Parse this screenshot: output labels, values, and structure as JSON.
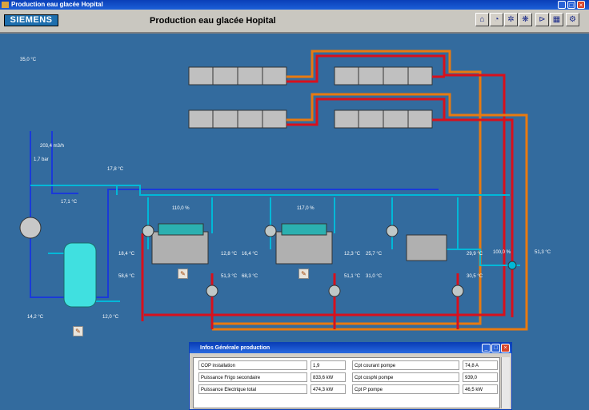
{
  "window": {
    "title": "Production eau glacée Hopital"
  },
  "header": {
    "logo": "SIEMENS",
    "title": "Production eau glacée Hopital"
  },
  "toolbar_icons": [
    "home-icon",
    "gauge-icon",
    "snowflake-icon",
    "fan-icon",
    "valve-icon",
    "chart-icon",
    "settings-icon"
  ],
  "labels": {
    "outdoor_temp": "35,0 °C",
    "flow": "203,4 m3/h",
    "pressure": "1,7 bar",
    "temp_171": "17,1 °C",
    "temp_178": "17,8 °C",
    "tank_left_temp": "14,2 °C",
    "tank_right_temp": "12,0 °C",
    "chiller1_load": "110,0 %",
    "chiller2_load": "117,0 %",
    "c1_in_top": "18,4 °C",
    "c1_out_top": "12,8 °C",
    "c1_in_bot": "58,6 °C",
    "c1_out_bot": "51,3 °C",
    "c2_in_top": "16,4 °C",
    "c2_in_bot": "68,3 °C",
    "c2_out_top": "12,3 °C",
    "c2_out_bot": "51,1 °C",
    "c3_in_top": "25,7 °C",
    "c3_in_bot": "31,0 °C",
    "c3_out_top": "29,9 °C",
    "c3_out_bot": "30,5 °C",
    "valve_pct": "100,0 %",
    "right_temp": "51,3 °C"
  },
  "info": {
    "title": "Infos Générale production",
    "rows": [
      {
        "l1": "COP installation",
        "v1": "1,9",
        "l2": "Cpt courant pompe",
        "v2": "74,8 A"
      },
      {
        "l1": "Puissance Frigo secondaire",
        "v1": "833,6 kW",
        "l2": "Cpt cosphi pompe",
        "v2": "939,0"
      },
      {
        "l1": "Puissance Electrique total",
        "v1": "474,3 kW",
        "l2": "Cpt P pompe",
        "v2": "46,5 kW"
      }
    ]
  },
  "colors": {
    "chilled": "#00b8d8",
    "hot": "#d8101c",
    "cold": "#1a3ad8",
    "condenser": "#e87a10"
  }
}
